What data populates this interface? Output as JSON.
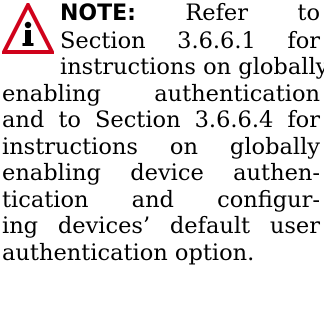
{
  "note": {
    "icon": "warning-triangle-icon",
    "icon_color": "#d0021b",
    "label": "NOTE:",
    "lines": [
      " Refer to",
      "Section 3.6.6.1 for",
      "instructions on globally",
      "enabling authentication",
      "and to Section 3.6.6.4 for",
      "instructions on globally",
      "enabling device authen-",
      "tication and configur-",
      "ing devices’ default user",
      "authentication option."
    ]
  }
}
